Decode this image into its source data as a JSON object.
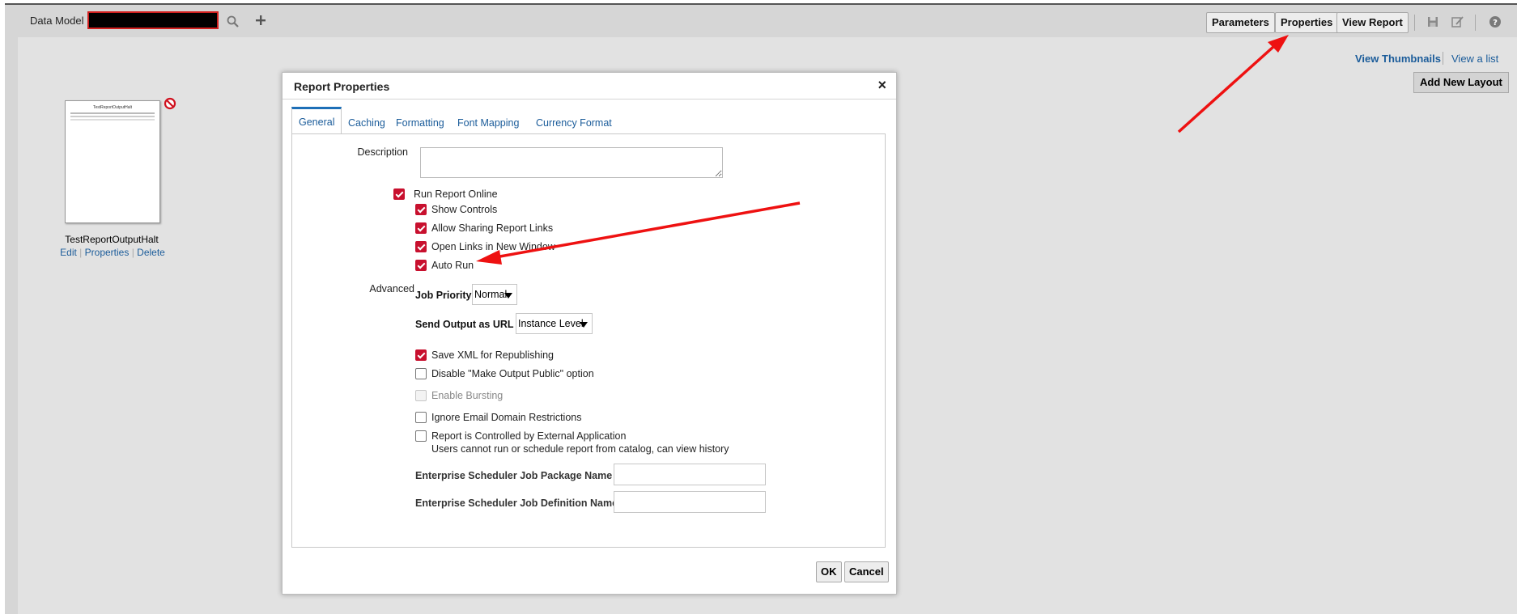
{
  "topbar": {
    "data_model_label": "Data Model",
    "buttons": {
      "parameters": "Parameters",
      "properties": "Properties",
      "view_report": "View Report"
    }
  },
  "layouts": {
    "view_thumbnails": "View Thumbnails",
    "view_list": "View a list",
    "add_new_layout": "Add New Layout",
    "item": {
      "name": "TestReportOutputHalt",
      "thumb_title": "TestReportOutputHalt",
      "edit": "Edit",
      "properties": "Properties",
      "delete": "Delete"
    }
  },
  "dialog": {
    "title": "Report Properties",
    "close": "×",
    "tabs": [
      "General",
      "Caching",
      "Formatting",
      "Font Mapping",
      "Currency Format"
    ],
    "description_label": "Description",
    "description_value": "",
    "run_report_online": {
      "label": "Run Report Online",
      "checked": true
    },
    "show_controls": {
      "label": "Show Controls",
      "checked": true
    },
    "allow_sharing": {
      "label": "Allow Sharing Report Links",
      "checked": true
    },
    "open_links": {
      "label": "Open Links in New Window",
      "checked": true
    },
    "auto_run": {
      "label": "Auto Run",
      "checked": true
    },
    "advanced_label": "Advanced",
    "job_priority": {
      "label": "Job Priority",
      "value": "Normal"
    },
    "send_output": {
      "label": "Send Output as URL",
      "value": "Instance Level"
    },
    "save_xml": {
      "label": "Save XML for Republishing",
      "checked": true
    },
    "disable_public": {
      "label": "Disable \"Make Output Public\" option",
      "checked": false
    },
    "enable_bursting": {
      "label": "Enable Bursting",
      "checked": false,
      "disabled": true
    },
    "ignore_email": {
      "label": "Ignore Email Domain Restrictions",
      "checked": false
    },
    "external_app": {
      "label": "Report is Controlled by External Application",
      "checked": false,
      "note": "Users cannot run or schedule report from catalog, can view history"
    },
    "ess_package": {
      "label": "Enterprise Scheduler Job Package Name",
      "value": ""
    },
    "ess_definition": {
      "label": "Enterprise Scheduler Job Definition Name",
      "value": ""
    },
    "ok": "OK",
    "cancel": "Cancel"
  },
  "colors": {
    "accent_red": "#c8102e",
    "link_blue": "#1b5c9a",
    "annotation_arrow": "#ee1111"
  }
}
